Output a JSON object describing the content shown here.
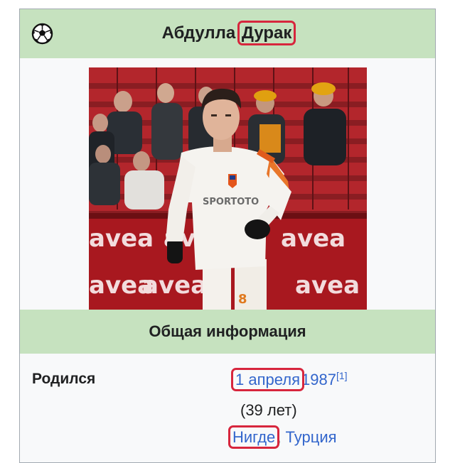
{
  "header": {
    "title_first": "Абдулла",
    "title_last": "Дурак",
    "icon": "soccer-ball-icon"
  },
  "section": {
    "general_info": "Общая информация"
  },
  "born": {
    "label": "Родился",
    "date_link": "1 апреля",
    "year_link": "1987",
    "ref": "[1]",
    "age": "(39 лет)",
    "place_link": "Нигде",
    "separator": ",",
    "country_link": "Турция"
  },
  "colors": {
    "header_bg": "#c6e2bf",
    "link": "#3366cc",
    "highlight": "#d7263d"
  }
}
